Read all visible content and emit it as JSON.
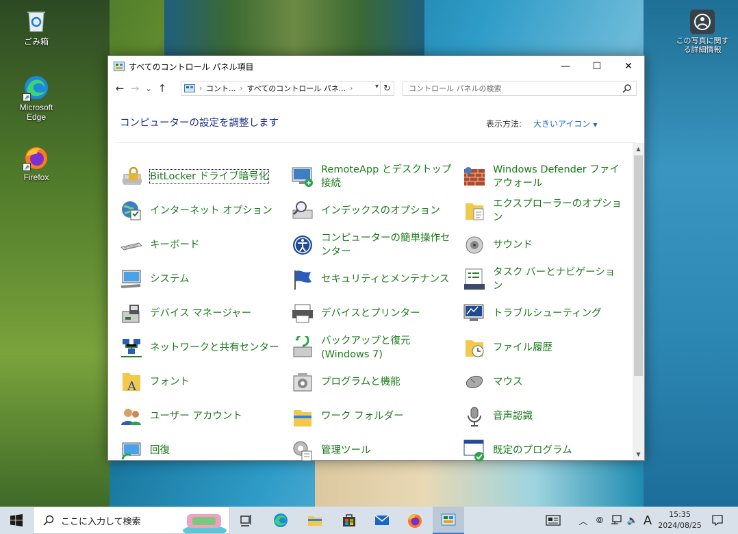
{
  "desktop": {
    "icons": [
      {
        "label": "ごみ箱",
        "icon": "recycle-bin-icon"
      },
      {
        "label": "Microsoft Edge",
        "icon": "edge-icon"
      },
      {
        "label": "Firefox",
        "icon": "firefox-icon"
      },
      {
        "label": "この写真に関する詳細情報",
        "icon": "photo-info-icon"
      }
    ]
  },
  "window": {
    "title": "すべてのコントロール パネル項目",
    "buttons": {
      "minimize": "—",
      "maximize": "☐",
      "close": "✕"
    },
    "nav": {
      "back": "←",
      "forward": "→",
      "recent": "⌄",
      "up": "↑"
    },
    "address": {
      "crumbs": [
        "コント...",
        "すべてのコントロール パネ..."
      ],
      "refresh": "↻"
    },
    "search_placeholder": "コントロール パネルの検索",
    "headline": "コンピューターの設定を調整します",
    "view_by_label": "表示方法:",
    "view_by_value": "大きいアイコン",
    "items": [
      {
        "label": "BitLocker ドライブ暗号化",
        "icon": "bitlocker-icon"
      },
      {
        "label": "RemoteApp とデスクトップ接続",
        "icon": "remoteapp-icon"
      },
      {
        "label": "Windows Defender ファイアウォール",
        "icon": "firewall-icon"
      },
      {
        "label": "インターネット オプション",
        "icon": "internet-options-icon"
      },
      {
        "label": "インデックスのオプション",
        "icon": "indexing-icon"
      },
      {
        "label": "エクスプローラーのオプション",
        "icon": "folder-options-icon"
      },
      {
        "label": "キーボード",
        "icon": "keyboard-icon"
      },
      {
        "label": "コンピューターの簡単操作センター",
        "icon": "ease-of-access-icon"
      },
      {
        "label": "サウンド",
        "icon": "sound-icon"
      },
      {
        "label": "システム",
        "icon": "system-icon"
      },
      {
        "label": "セキュリティとメンテナンス",
        "icon": "security-flag-icon"
      },
      {
        "label": "タスク バーとナビゲーション",
        "icon": "taskbar-icon"
      },
      {
        "label": "デバイス マネージャー",
        "icon": "device-manager-icon"
      },
      {
        "label": "デバイスとプリンター",
        "icon": "printer-icon"
      },
      {
        "label": "トラブルシューティング",
        "icon": "troubleshoot-icon"
      },
      {
        "label": "ネットワークと共有センター",
        "icon": "network-icon"
      },
      {
        "label": "バックアップと復元 (Windows 7)",
        "icon": "backup-icon"
      },
      {
        "label": "ファイル履歴",
        "icon": "file-history-icon"
      },
      {
        "label": "フォント",
        "icon": "fonts-icon"
      },
      {
        "label": "プログラムと機能",
        "icon": "programs-icon"
      },
      {
        "label": "マウス",
        "icon": "mouse-icon"
      },
      {
        "label": "ユーザー アカウント",
        "icon": "user-accounts-icon"
      },
      {
        "label": "ワーク フォルダー",
        "icon": "work-folders-icon"
      },
      {
        "label": "音声認識",
        "icon": "microphone-icon"
      },
      {
        "label": "回復",
        "icon": "recovery-icon"
      },
      {
        "label": "管理ツール",
        "icon": "admin-tools-icon"
      },
      {
        "label": "既定のプログラム",
        "icon": "default-programs-icon"
      }
    ]
  },
  "taskbar": {
    "search_placeholder": "ここに入力して検索",
    "ime": "A",
    "time": "15:35",
    "date": "2024/08/25"
  },
  "colors": {
    "link_green": "#1a7a1a",
    "headline_blue": "#1e3287",
    "accent": "#1a66c8"
  }
}
